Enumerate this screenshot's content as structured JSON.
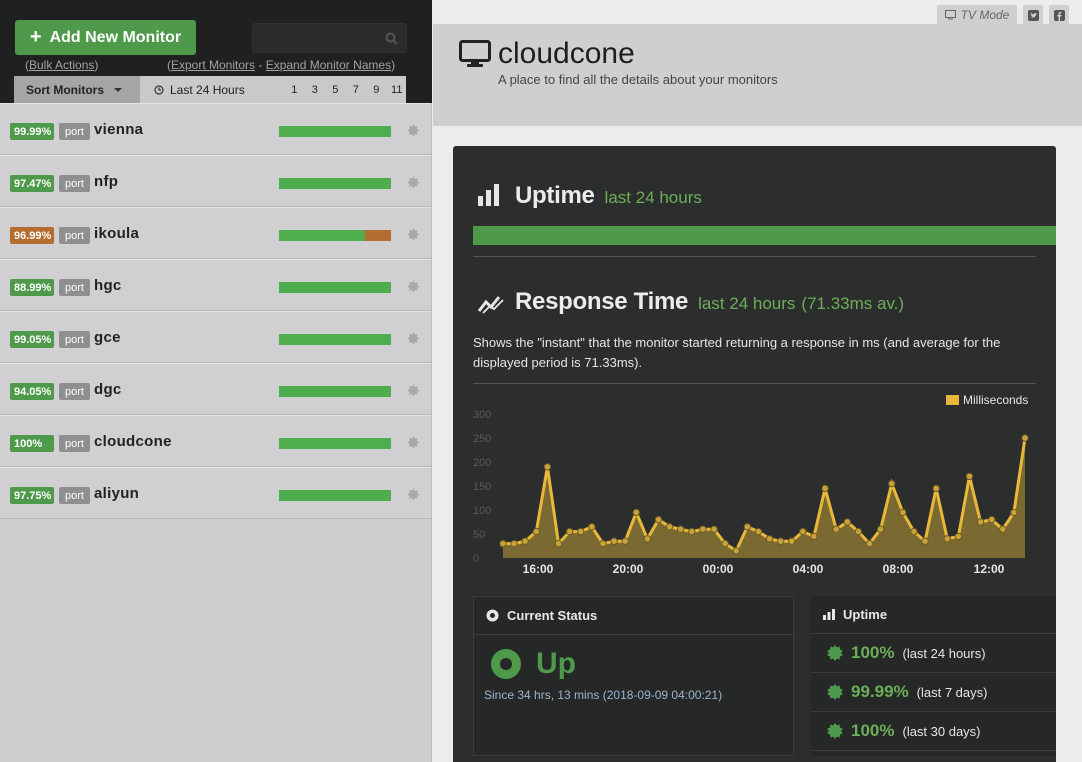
{
  "sidebar": {
    "add_button_label": "Add New Monitor",
    "search_placeholder": "",
    "bulk_actions_prefix": "(",
    "bulk_actions_label": "Bulk Actions",
    "bulk_actions_suffix": ")",
    "export_prefix": "(",
    "export_label": "Export Monitors",
    "export_sep": " - ",
    "expand_label": "Expand Monitor Names",
    "export_suffix": ")",
    "sort_label": "Sort Monitors",
    "range_label": "Last 24 Hours",
    "range_options": [
      "1",
      "3",
      "5",
      "7",
      "9",
      "11"
    ]
  },
  "monitors": [
    {
      "name": "vienna",
      "uptime": "99.99%",
      "type": "port",
      "badge_color": "#4e9a4a",
      "uptime_fraction": 0.9999,
      "down_fraction": 0
    },
    {
      "name": "nfp",
      "uptime": "97.47%",
      "type": "port",
      "badge_color": "#4e9a4a",
      "uptime_fraction": 0.9747,
      "down_fraction": 0
    },
    {
      "name": "ikoula",
      "uptime": "96.99%",
      "type": "port",
      "badge_color": "#b56d2f",
      "uptime_fraction": 0.9699,
      "down_fraction": 0.23
    },
    {
      "name": "hgc",
      "uptime": "88.99%",
      "type": "port",
      "badge_color": "#4e9a4a",
      "uptime_fraction": 0.8899,
      "down_fraction": 0
    },
    {
      "name": "gce",
      "uptime": "99.05%",
      "type": "port",
      "badge_color": "#4e9a4a",
      "uptime_fraction": 0.9905,
      "down_fraction": 0
    },
    {
      "name": "dgc",
      "uptime": "94.05%",
      "type": "port",
      "badge_color": "#4e9a4a",
      "uptime_fraction": 0.9405,
      "down_fraction": 0
    },
    {
      "name": "cloudcone",
      "uptime": "100%",
      "type": "port",
      "badge_color": "#4e9a4a",
      "uptime_fraction": 1.0,
      "down_fraction": 0
    },
    {
      "name": "aliyun",
      "uptime": "97.75%",
      "type": "port",
      "badge_color": "#4e9a4a",
      "uptime_fraction": 0.9775,
      "down_fraction": 0
    }
  ],
  "header": {
    "title": "cloudcone",
    "subtitle": "A place to find all the details about your monitors",
    "tv_mode_label": "TV Mode"
  },
  "uptime_section": {
    "title": "Uptime",
    "period": "last 24 hours"
  },
  "response_section": {
    "title": "Response Time",
    "period": "last 24 hours",
    "average": "(71.33ms av.)",
    "description": "Shows the \"instant\" that the monitor started returning a response in ms (and average for the displayed period is 71.33ms)."
  },
  "chart_data": {
    "type": "area",
    "legend": [
      "Milliseconds"
    ],
    "legend_position": "top-right",
    "series_color": "#e8b83a",
    "ylim": [
      0,
      300
    ],
    "y_ticks": [
      "0",
      "50",
      "100",
      "150",
      "200",
      "250",
      "300"
    ],
    "x_ticks": [
      "16:00",
      "20:00",
      "00:00",
      "04:00",
      "08:00",
      "12:00"
    ],
    "series": [
      {
        "name": "Milliseconds",
        "values": [
          30,
          30,
          35,
          55,
          190,
          30,
          55,
          55,
          65,
          30,
          35,
          35,
          95,
          40,
          80,
          65,
          60,
          55,
          60,
          60,
          30,
          15,
          65,
          55,
          40,
          35,
          35,
          55,
          45,
          145,
          60,
          75,
          55,
          30,
          60,
          155,
          95,
          55,
          35,
          145,
          40,
          45,
          170,
          75,
          80,
          60,
          95,
          250
        ]
      }
    ]
  },
  "current_status": {
    "title": "Current Status",
    "state": "Up",
    "since": "Since 34 hrs, 13 mins (2018-09-09 04:00:21)"
  },
  "uptime_panel": {
    "title": "Uptime",
    "rows": [
      {
        "value": "100%",
        "period": "(last 24 hours)"
      },
      {
        "value": "99.99%",
        "period": "(last 7 days)"
      },
      {
        "value": "100%",
        "period": "(last 30 days)"
      }
    ]
  }
}
